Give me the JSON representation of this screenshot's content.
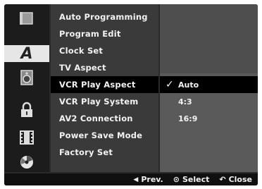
{
  "menu": {
    "items": [
      {
        "label": "Auto Programming"
      },
      {
        "label": "Program Edit"
      },
      {
        "label": "Clock Set"
      },
      {
        "label": "TV Aspect"
      },
      {
        "label": "VCR Play Aspect"
      },
      {
        "label": "VCR Play System"
      },
      {
        "label": "AV2 Connection"
      },
      {
        "label": "Power Save Mode"
      },
      {
        "label": "Factory Set"
      }
    ],
    "selected": "VCR Play Aspect"
  },
  "sidebar": {
    "icons": [
      {
        "name": "display-icon"
      },
      {
        "name": "language-icon",
        "letter": "A"
      },
      {
        "name": "audio-icon"
      },
      {
        "name": "lock-icon"
      },
      {
        "name": "film-icon"
      },
      {
        "name": "disc-icon"
      }
    ],
    "selected": "language-icon"
  },
  "options": {
    "items": [
      {
        "label": "Auto",
        "checked": true
      },
      {
        "label": "4:3",
        "checked": false
      },
      {
        "label": "16:9",
        "checked": false
      }
    ],
    "check_glyph": "✓"
  },
  "bottom_bar": {
    "prev_label": "Prev.",
    "prev_icon": "◀",
    "select_label": "Select",
    "select_icon": "⊙",
    "close_label": "Close",
    "close_icon": "↶"
  },
  "colors": {
    "menu_bg": "#3a3a3a",
    "highlight": "#000000",
    "icon_selected_bg": "#e6e6e6",
    "text": "#f2f2f2"
  }
}
